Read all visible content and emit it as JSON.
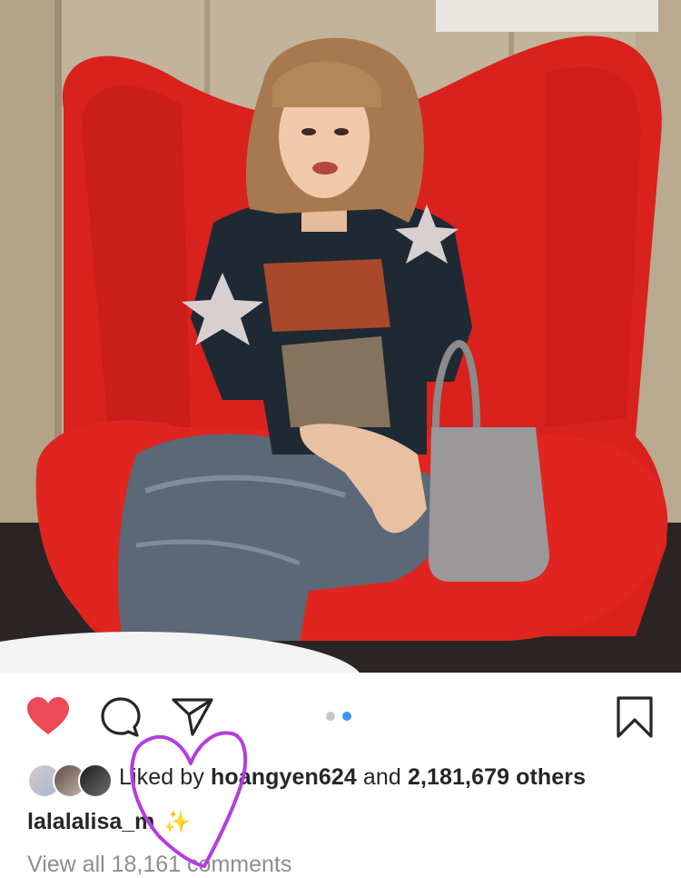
{
  "post": {
    "image_alt": "Woman in AC/DC shirt sitting in red egg chair",
    "carousel": {
      "total": 2,
      "active": 2
    }
  },
  "actions": {
    "like_icon": "heart-icon",
    "comment_icon": "comment-icon",
    "share_icon": "send-icon",
    "save_icon": "bookmark-icon",
    "like_color": "#ed4956"
  },
  "likes": {
    "prefix": "Liked by ",
    "user": "hoangyen624",
    "middle": " and ",
    "count": "2,181,679 others"
  },
  "caption": {
    "username": "lalalalisa_m",
    "emoji": "✨"
  },
  "comments": {
    "view_all": "View all 18,161 comments"
  }
}
